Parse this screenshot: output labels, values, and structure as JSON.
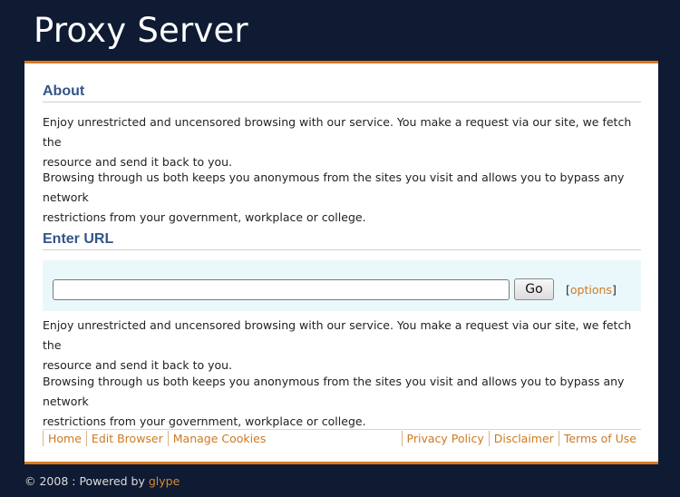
{
  "header": {
    "title": "Proxy Server"
  },
  "about": {
    "heading": "About",
    "para1_line1": "Enjoy unrestricted and uncensored browsing with our service. You make a request via our site, we fetch the",
    "para1_line2": "resource and send it back to you.",
    "para2_line1": "Browsing through us both keeps you anonymous from the sites you visit and allows you to bypass any network",
    "para2_line2": "restrictions from your government, workplace or college."
  },
  "enter_url": {
    "heading": "Enter URL",
    "input_value": "",
    "go_label": "Go",
    "options_open": "[",
    "options_label": "options",
    "options_close": "]",
    "para1_line1": "Enjoy unrestricted and uncensored browsing with our service. You make a request via our site, we fetch the",
    "para1_line2": "resource and send it back to you.",
    "para2_line1": "Browsing through us both keeps you anonymous from the sites you visit and allows you to bypass any network",
    "para2_line2": "restrictions from your government, workplace or college."
  },
  "footer_nav": {
    "left": [
      "Home",
      "Edit Browser",
      "Manage Cookies"
    ],
    "right": [
      "Privacy Policy",
      "Disclaimer",
      "Terms of Use"
    ]
  },
  "copyright": {
    "text": "© 2008 : Powered by ",
    "link": "glype"
  },
  "colors": {
    "background": "#0f1a33",
    "accent": "#d97a1f",
    "heading": "#335588",
    "link": "#cc7a22",
    "url_box": "#eaf8fb"
  }
}
